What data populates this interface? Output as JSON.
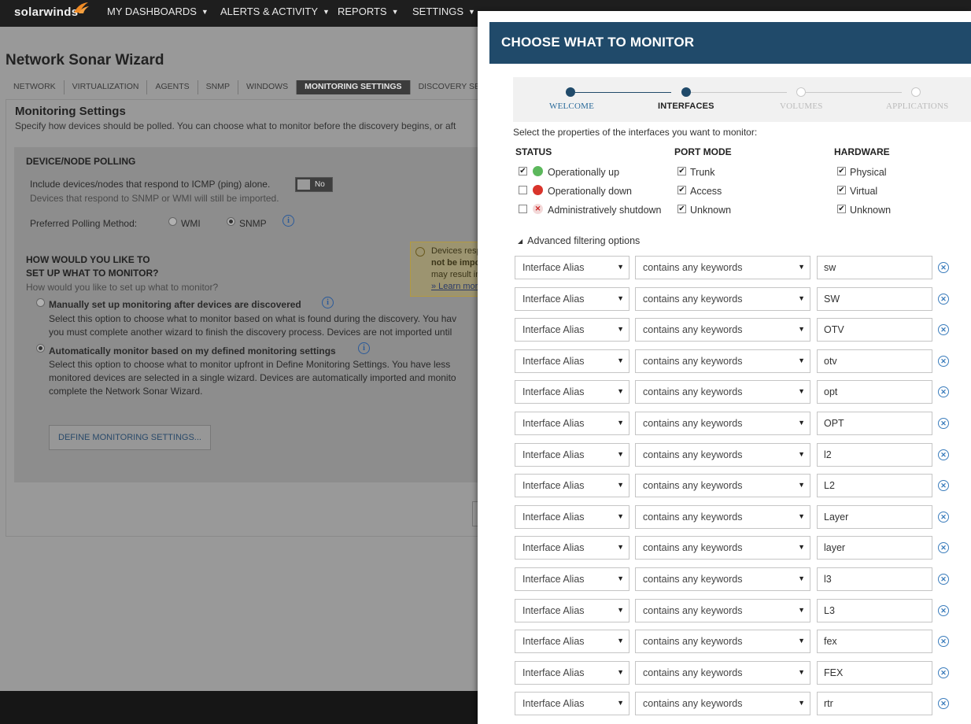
{
  "app": {
    "logo_text": "solarwinds",
    "nav": [
      "MY DASHBOARDS",
      "ALERTS & ACTIVITY",
      "REPORTS",
      "SETTINGS"
    ]
  },
  "wizard": {
    "title": "Network Sonar Wizard",
    "breadcrumbs": [
      "NETWORK",
      "VIRTUALIZATION",
      "AGENTS",
      "SNMP",
      "WINDOWS",
      "MONITORING SETTINGS",
      "DISCOVERY SETTI"
    ],
    "active_step": "MONITORING SETTINGS",
    "section_title": "Monitoring Settings",
    "section_desc": "Specify how devices should be polled. You can choose what to monitor before the discovery begins, or aft",
    "polling": {
      "title": "DEVICE/NODE POLLING",
      "icmp_label": "Include devices/nodes that respond to ICMP (ping) alone.",
      "icmp_toggle": "No",
      "icmp_note": "Devices that respond to SNMP or WMI will still be imported.",
      "method_label": "Preferred Polling Method:",
      "method_options": [
        "WMI",
        "SNMP"
      ],
      "method_selected": "SNMP"
    },
    "tip_lines": [
      "Devices respo",
      "not be impor",
      "may result in",
      "» Learn more"
    ],
    "setup": {
      "title_line1": "HOW WOULD YOU LIKE TO",
      "title_line2": "SET UP WHAT TO MONITOR?",
      "question": "How would you like to set up what to monitor?",
      "manual_label": "Manually set up monitoring after devices are discovered",
      "manual_desc": [
        "Select this option to choose what to monitor based on what is found during the discovery. You hav",
        "you must complete another wizard to finish the discovery process. Devices are not imported until"
      ],
      "auto_label": "Automatically monitor based on my defined monitoring settings",
      "auto_desc": [
        "Select this option to choose what to monitor upfront in Define Monitoring Settings. You have less",
        "monitored devices are selected in a single wizard. Devices are automatically imported and monito",
        "complete the Network Sonar Wizard."
      ],
      "selected": "auto",
      "define_button": "DEFINE MONITORING SETTINGS..."
    }
  },
  "modal": {
    "title": "CHOOSE WHAT TO MONITOR",
    "steps": [
      "WELCOME",
      "INTERFACES",
      "VOLUMES",
      "APPLICATIONS"
    ],
    "current_step": "INTERFACES",
    "prompt": "Select the properties of the interfaces you want to monitor:",
    "status": {
      "header": "STATUS",
      "items": [
        {
          "label": "Operationally up",
          "checked": true
        },
        {
          "label": "Operationally down",
          "checked": false
        },
        {
          "label": "Administratively shutdown",
          "checked": false
        }
      ]
    },
    "port_mode": {
      "header": "PORT MODE",
      "items": [
        {
          "label": "Trunk",
          "checked": true
        },
        {
          "label": "Access",
          "checked": true
        },
        {
          "label": "Unknown",
          "checked": true
        }
      ]
    },
    "hardware": {
      "header": "HARDWARE",
      "items": [
        {
          "label": "Physical",
          "checked": true
        },
        {
          "label": "Virtual",
          "checked": true
        },
        {
          "label": "Unknown",
          "checked": true
        }
      ]
    },
    "advanced_label": "Advanced filtering options",
    "filters": [
      {
        "field": "Interface Alias",
        "operator": "contains any keywords",
        "value": "sw"
      },
      {
        "field": "Interface Alias",
        "operator": "contains any keywords",
        "value": "SW"
      },
      {
        "field": "Interface Alias",
        "operator": "contains any keywords",
        "value": "OTV"
      },
      {
        "field": "Interface Alias",
        "operator": "contains any keywords",
        "value": "otv"
      },
      {
        "field": "Interface Alias",
        "operator": "contains any keywords",
        "value": "opt"
      },
      {
        "field": "Interface Alias",
        "operator": "contains any keywords",
        "value": "OPT"
      },
      {
        "field": "Interface Alias",
        "operator": "contains any keywords",
        "value": "l2"
      },
      {
        "field": "Interface Alias",
        "operator": "contains any keywords",
        "value": "L2"
      },
      {
        "field": "Interface Alias",
        "operator": "contains any keywords",
        "value": "Layer"
      },
      {
        "field": "Interface Alias",
        "operator": "contains any keywords",
        "value": "layer"
      },
      {
        "field": "Interface Alias",
        "operator": "contains any keywords",
        "value": "l3"
      },
      {
        "field": "Interface Alias",
        "operator": "contains any keywords",
        "value": "L3"
      },
      {
        "field": "Interface Alias",
        "operator": "contains any keywords",
        "value": "fex"
      },
      {
        "field": "Interface Alias",
        "operator": "contains any keywords",
        "value": "FEX"
      },
      {
        "field": "Interface Alias",
        "operator": "contains any keywords",
        "value": "rtr"
      }
    ]
  },
  "colors": {
    "modal_header": "#204a6a",
    "status_up": "#5cb85c",
    "status_down": "#d9342b",
    "remove_icon": "#3a7cbc"
  }
}
